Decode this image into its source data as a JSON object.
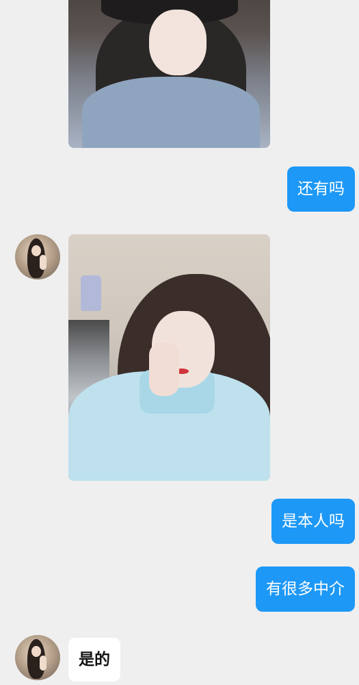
{
  "messages": [
    {
      "side": "in",
      "type": "image",
      "alt": "photo"
    },
    {
      "side": "out",
      "type": "text",
      "text": "还有吗"
    },
    {
      "side": "in",
      "type": "image",
      "alt": "photo"
    },
    {
      "side": "out",
      "type": "text",
      "text": "是本人吗"
    },
    {
      "side": "out",
      "type": "text",
      "text": "有很多中介"
    },
    {
      "side": "in",
      "type": "text",
      "text": "是的"
    }
  ],
  "colors": {
    "background": "#efeff0",
    "outgoing_bubble": "#1d98f7",
    "incoming_bubble": "#ffffff"
  }
}
